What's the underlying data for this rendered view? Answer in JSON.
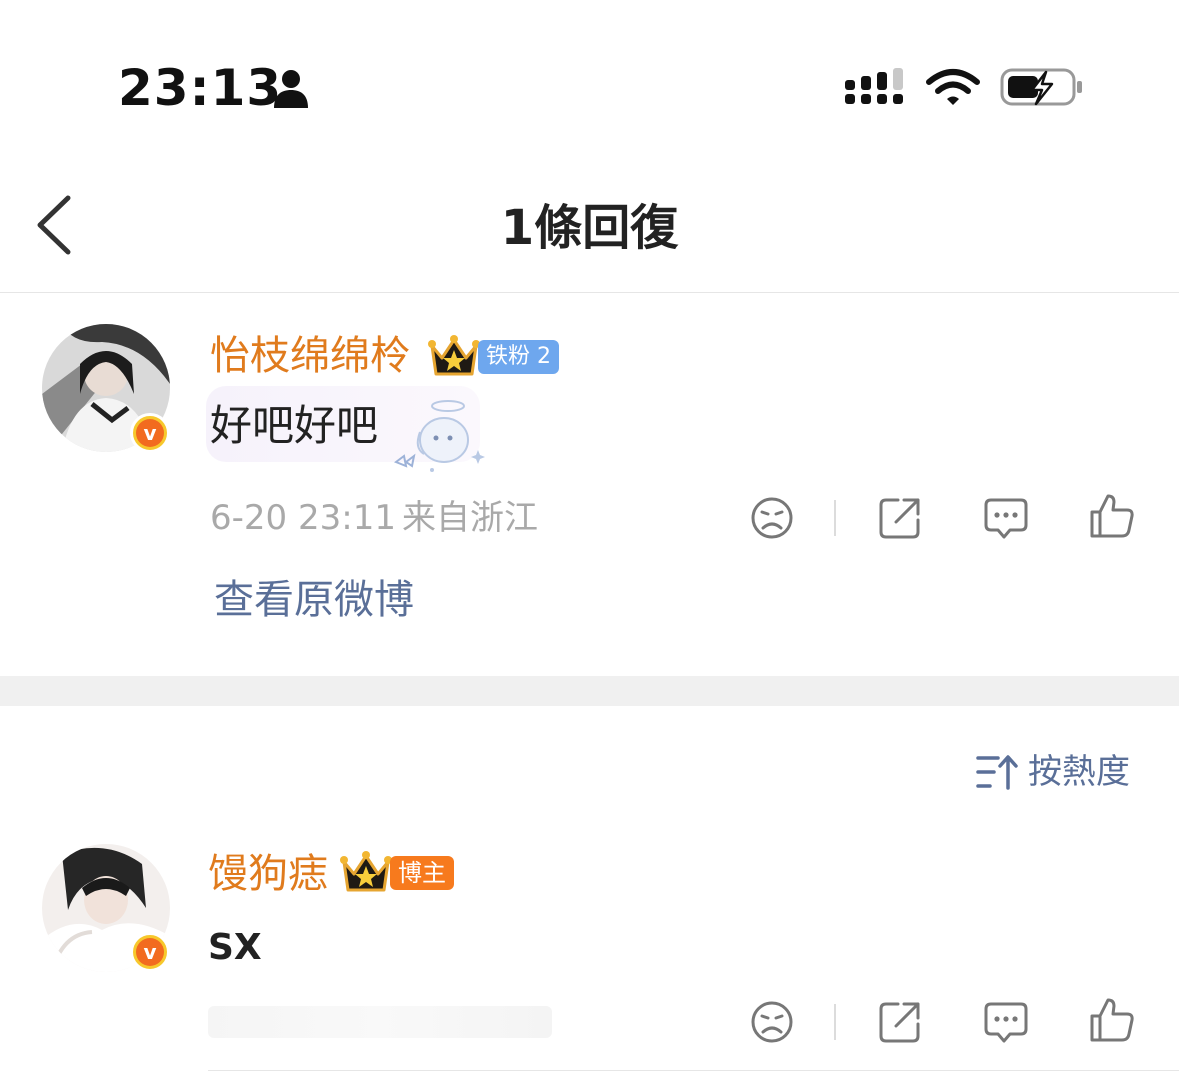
{
  "status_bar": {
    "time": "23:13",
    "icons": [
      "person-icon",
      "signal-icon",
      "wifi-icon",
      "battery-charging-icon"
    ]
  },
  "nav": {
    "title": "1條回復",
    "back_icon": "chevron-left-icon"
  },
  "comment": {
    "username": "怡枝绵绵柃",
    "badge": "铁粉 2",
    "text": "好吧好吧",
    "time": "6-20 23:11",
    "location": "来自浙江",
    "view_original": "查看原微博"
  },
  "sort": {
    "label": "按熱度",
    "icon": "sort-icon"
  },
  "reply": {
    "username": "馒狗痣",
    "badge": "博主",
    "text": "SX"
  },
  "colors": {
    "username": "#e07b1d",
    "link": "#5a6f98",
    "iron_badge": "#6ea7ee",
    "blogger_badge": "#f77a1d",
    "meta": "#a9a9a9"
  }
}
